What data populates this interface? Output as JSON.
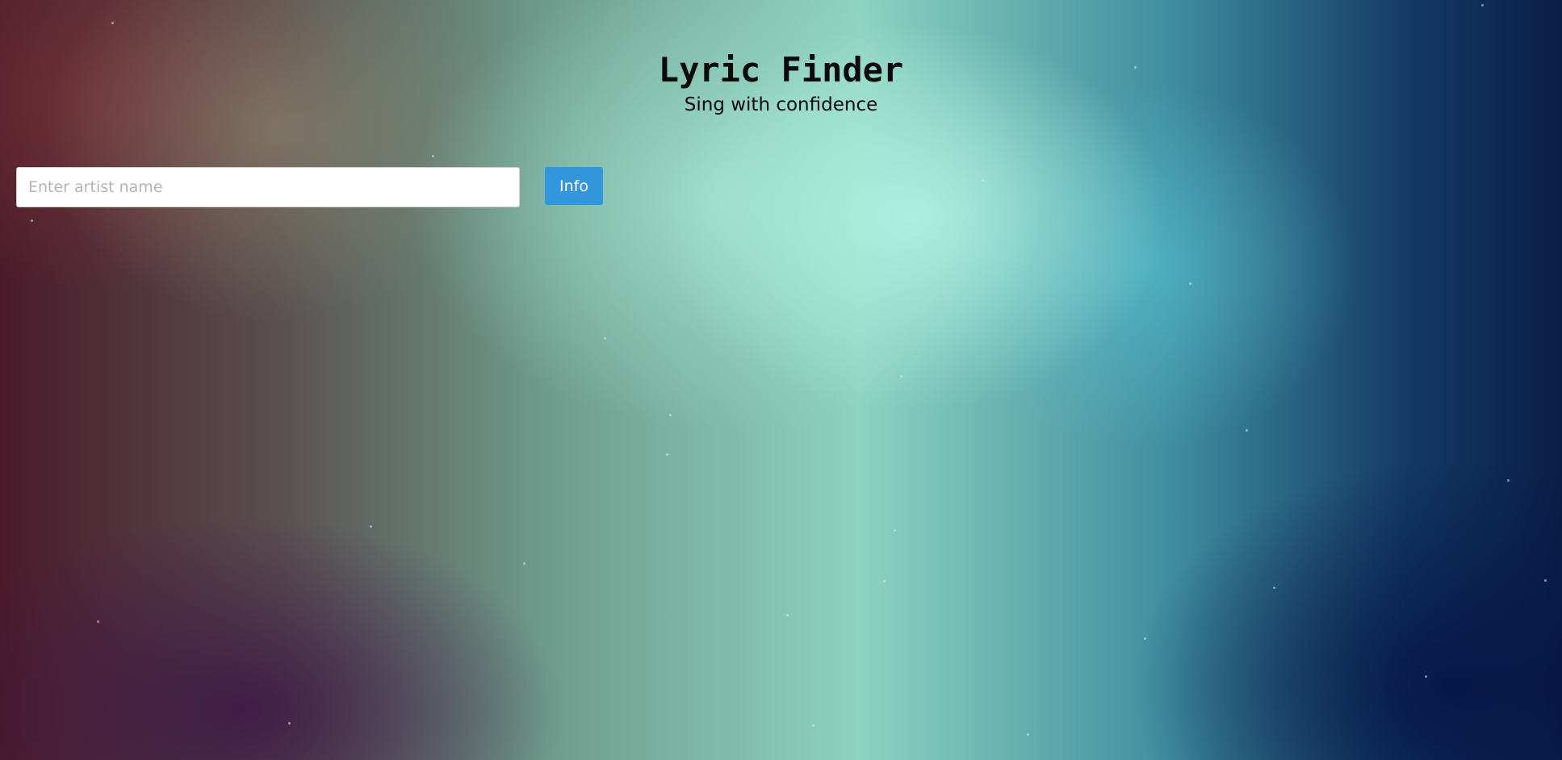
{
  "header": {
    "title": "Lyric Finder",
    "subtitle": "Sing with confidence"
  },
  "search": {
    "placeholder": "Enter artist name",
    "value": "",
    "button_label": "Info"
  },
  "colors": {
    "button": "#3296dd",
    "text": "#0b0b0b"
  }
}
